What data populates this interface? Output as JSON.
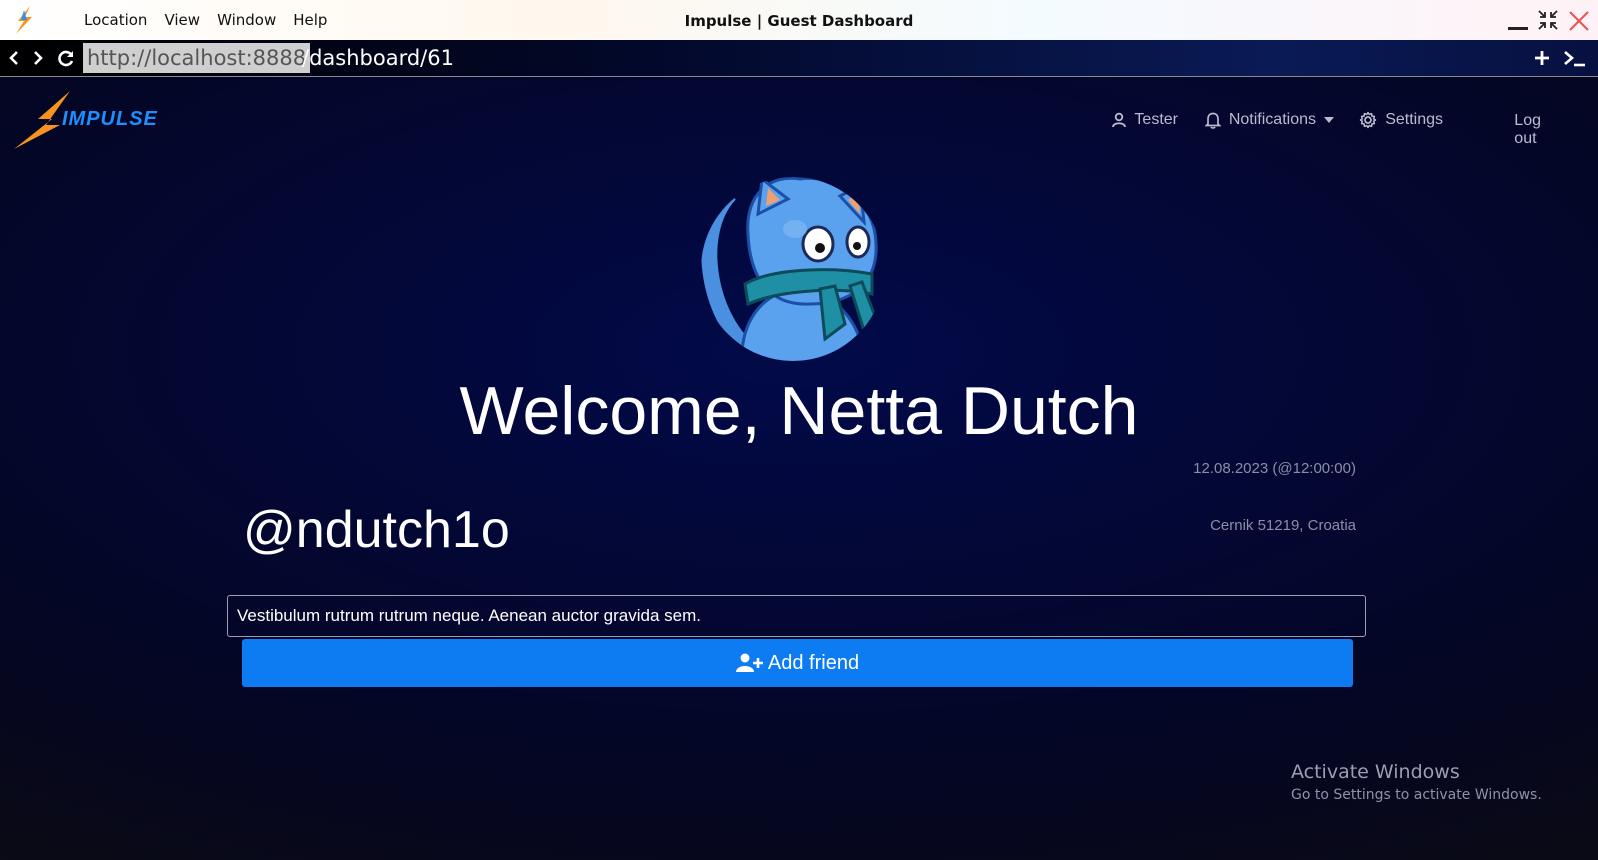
{
  "window": {
    "title": "Impulse | Guest Dashboard",
    "menu": [
      "Location",
      "View",
      "Window",
      "Help"
    ]
  },
  "address": {
    "host": "http://localhost:8888",
    "path": "/dashboard/61"
  },
  "nav": {
    "user_label": "Tester",
    "notifications_label": "Notifications",
    "settings_label": "Settings",
    "logout_label": "Log out"
  },
  "brand": {
    "name": "IMPULSE"
  },
  "profile": {
    "welcome": "Welcome, Netta Dutch",
    "date": "12.08.2023 (@12:00:00)",
    "handle": "@ndutch1o",
    "location": "Cernik 51219, Croatia",
    "bio": "Vestibulum rutrum rutrum neque. Aenean auctor gravida sem.",
    "add_friend_label": "Add friend"
  },
  "watermark": {
    "line1": "Activate Windows",
    "line2": "Go to Settings to activate Windows."
  },
  "colors": {
    "accent": "#0d7cf2",
    "logo_orange": "#f7931e",
    "logo_blue": "#1e8fff"
  },
  "icons": [
    "impulse-logo-icon",
    "back-icon",
    "forward-icon",
    "refresh-icon",
    "plus-icon",
    "terminal-icon",
    "minimize-icon",
    "restore-icon",
    "close-icon",
    "user-icon",
    "bell-icon",
    "caret-down-icon",
    "gear-icon",
    "user-plus-icon",
    "cat-avatar"
  ]
}
